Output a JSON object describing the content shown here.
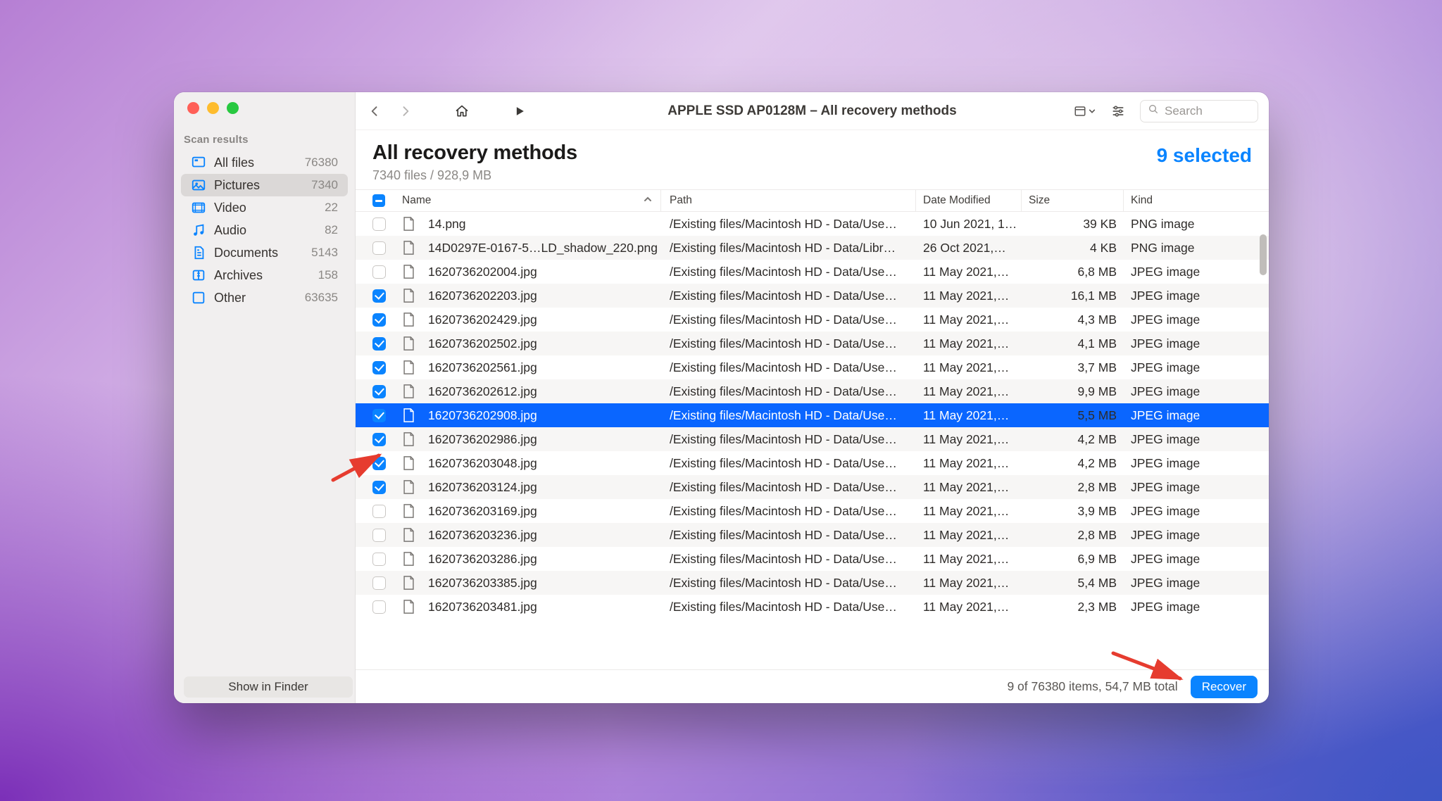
{
  "toolbar": {
    "title": "APPLE SSD AP0128M – All recovery methods",
    "search_placeholder": "Search"
  },
  "sidebar": {
    "heading": "Scan results",
    "items": [
      {
        "id": "all-files",
        "label": "All files",
        "count": "76380"
      },
      {
        "id": "pictures",
        "label": "Pictures",
        "count": "7340",
        "active": true
      },
      {
        "id": "video",
        "label": "Video",
        "count": "22"
      },
      {
        "id": "audio",
        "label": "Audio",
        "count": "82"
      },
      {
        "id": "documents",
        "label": "Documents",
        "count": "5143"
      },
      {
        "id": "archives",
        "label": "Archives",
        "count": "158"
      },
      {
        "id": "other",
        "label": "Other",
        "count": "63635"
      }
    ]
  },
  "header": {
    "title": "All recovery methods",
    "subtitle": "7340 files / 928,9 MB",
    "selected": "9 selected"
  },
  "columns": {
    "name": "Name",
    "path": "Path",
    "date": "Date Modified",
    "size": "Size",
    "kind": "Kind"
  },
  "rows": [
    {
      "checked": false,
      "name": "14.png",
      "path": "/Existing files/Macintosh HD - Data/Use…",
      "date": "10 Jun 2021, 1…",
      "size": "39 KB",
      "kind": "PNG image"
    },
    {
      "checked": false,
      "name": "14D0297E-0167-5…LD_shadow_220.png",
      "path": "/Existing files/Macintosh HD - Data/Libr…",
      "date": "26 Oct 2021,…",
      "size": "4 KB",
      "kind": "PNG image"
    },
    {
      "checked": false,
      "name": "1620736202004.jpg",
      "path": "/Existing files/Macintosh HD - Data/Use…",
      "date": "11 May 2021,…",
      "size": "6,8 MB",
      "kind": "JPEG image"
    },
    {
      "checked": true,
      "name": "1620736202203.jpg",
      "path": "/Existing files/Macintosh HD - Data/Use…",
      "date": "11 May 2021,…",
      "size": "16,1 MB",
      "kind": "JPEG image"
    },
    {
      "checked": true,
      "name": "1620736202429.jpg",
      "path": "/Existing files/Macintosh HD - Data/Use…",
      "date": "11 May 2021,…",
      "size": "4,3 MB",
      "kind": "JPEG image"
    },
    {
      "checked": true,
      "name": "1620736202502.jpg",
      "path": "/Existing files/Macintosh HD - Data/Use…",
      "date": "11 May 2021,…",
      "size": "4,1 MB",
      "kind": "JPEG image"
    },
    {
      "checked": true,
      "name": "1620736202561.jpg",
      "path": "/Existing files/Macintosh HD - Data/Use…",
      "date": "11 May 2021,…",
      "size": "3,7 MB",
      "kind": "JPEG image"
    },
    {
      "checked": true,
      "name": "1620736202612.jpg",
      "path": "/Existing files/Macintosh HD - Data/Use…",
      "date": "11 May 2021,…",
      "size": "9,9 MB",
      "kind": "JPEG image"
    },
    {
      "checked": true,
      "name": "1620736202908.jpg",
      "path": "/Existing files/Macintosh HD - Data/Use…",
      "date": "11 May 2021,…",
      "size": "5,5 MB",
      "kind": "JPEG image",
      "selected": true
    },
    {
      "checked": true,
      "name": "1620736202986.jpg",
      "path": "/Existing files/Macintosh HD - Data/Use…",
      "date": "11 May 2021,…",
      "size": "4,2 MB",
      "kind": "JPEG image"
    },
    {
      "checked": true,
      "name": "1620736203048.jpg",
      "path": "/Existing files/Macintosh HD - Data/Use…",
      "date": "11 May 2021,…",
      "size": "4,2 MB",
      "kind": "JPEG image"
    },
    {
      "checked": true,
      "name": "1620736203124.jpg",
      "path": "/Existing files/Macintosh HD - Data/Use…",
      "date": "11 May 2021,…",
      "size": "2,8 MB",
      "kind": "JPEG image"
    },
    {
      "checked": false,
      "name": "1620736203169.jpg",
      "path": "/Existing files/Macintosh HD - Data/Use…",
      "date": "11 May 2021,…",
      "size": "3,9 MB",
      "kind": "JPEG image"
    },
    {
      "checked": false,
      "name": "1620736203236.jpg",
      "path": "/Existing files/Macintosh HD - Data/Use…",
      "date": "11 May 2021,…",
      "size": "2,8 MB",
      "kind": "JPEG image"
    },
    {
      "checked": false,
      "name": "1620736203286.jpg",
      "path": "/Existing files/Macintosh HD - Data/Use…",
      "date": "11 May 2021,…",
      "size": "6,9 MB",
      "kind": "JPEG image"
    },
    {
      "checked": false,
      "name": "1620736203385.jpg",
      "path": "/Existing files/Macintosh HD - Data/Use…",
      "date": "11 May 2021,…",
      "size": "5,4 MB",
      "kind": "JPEG image"
    },
    {
      "checked": false,
      "name": "1620736203481.jpg",
      "path": "/Existing files/Macintosh HD - Data/Use…",
      "date": "11 May 2021,…",
      "size": "2,3 MB",
      "kind": "JPEG image"
    }
  ],
  "footer": {
    "show_in_finder": "Show in Finder",
    "status": "9 of 76380 items, 54,7 MB total",
    "recover": "Recover"
  }
}
